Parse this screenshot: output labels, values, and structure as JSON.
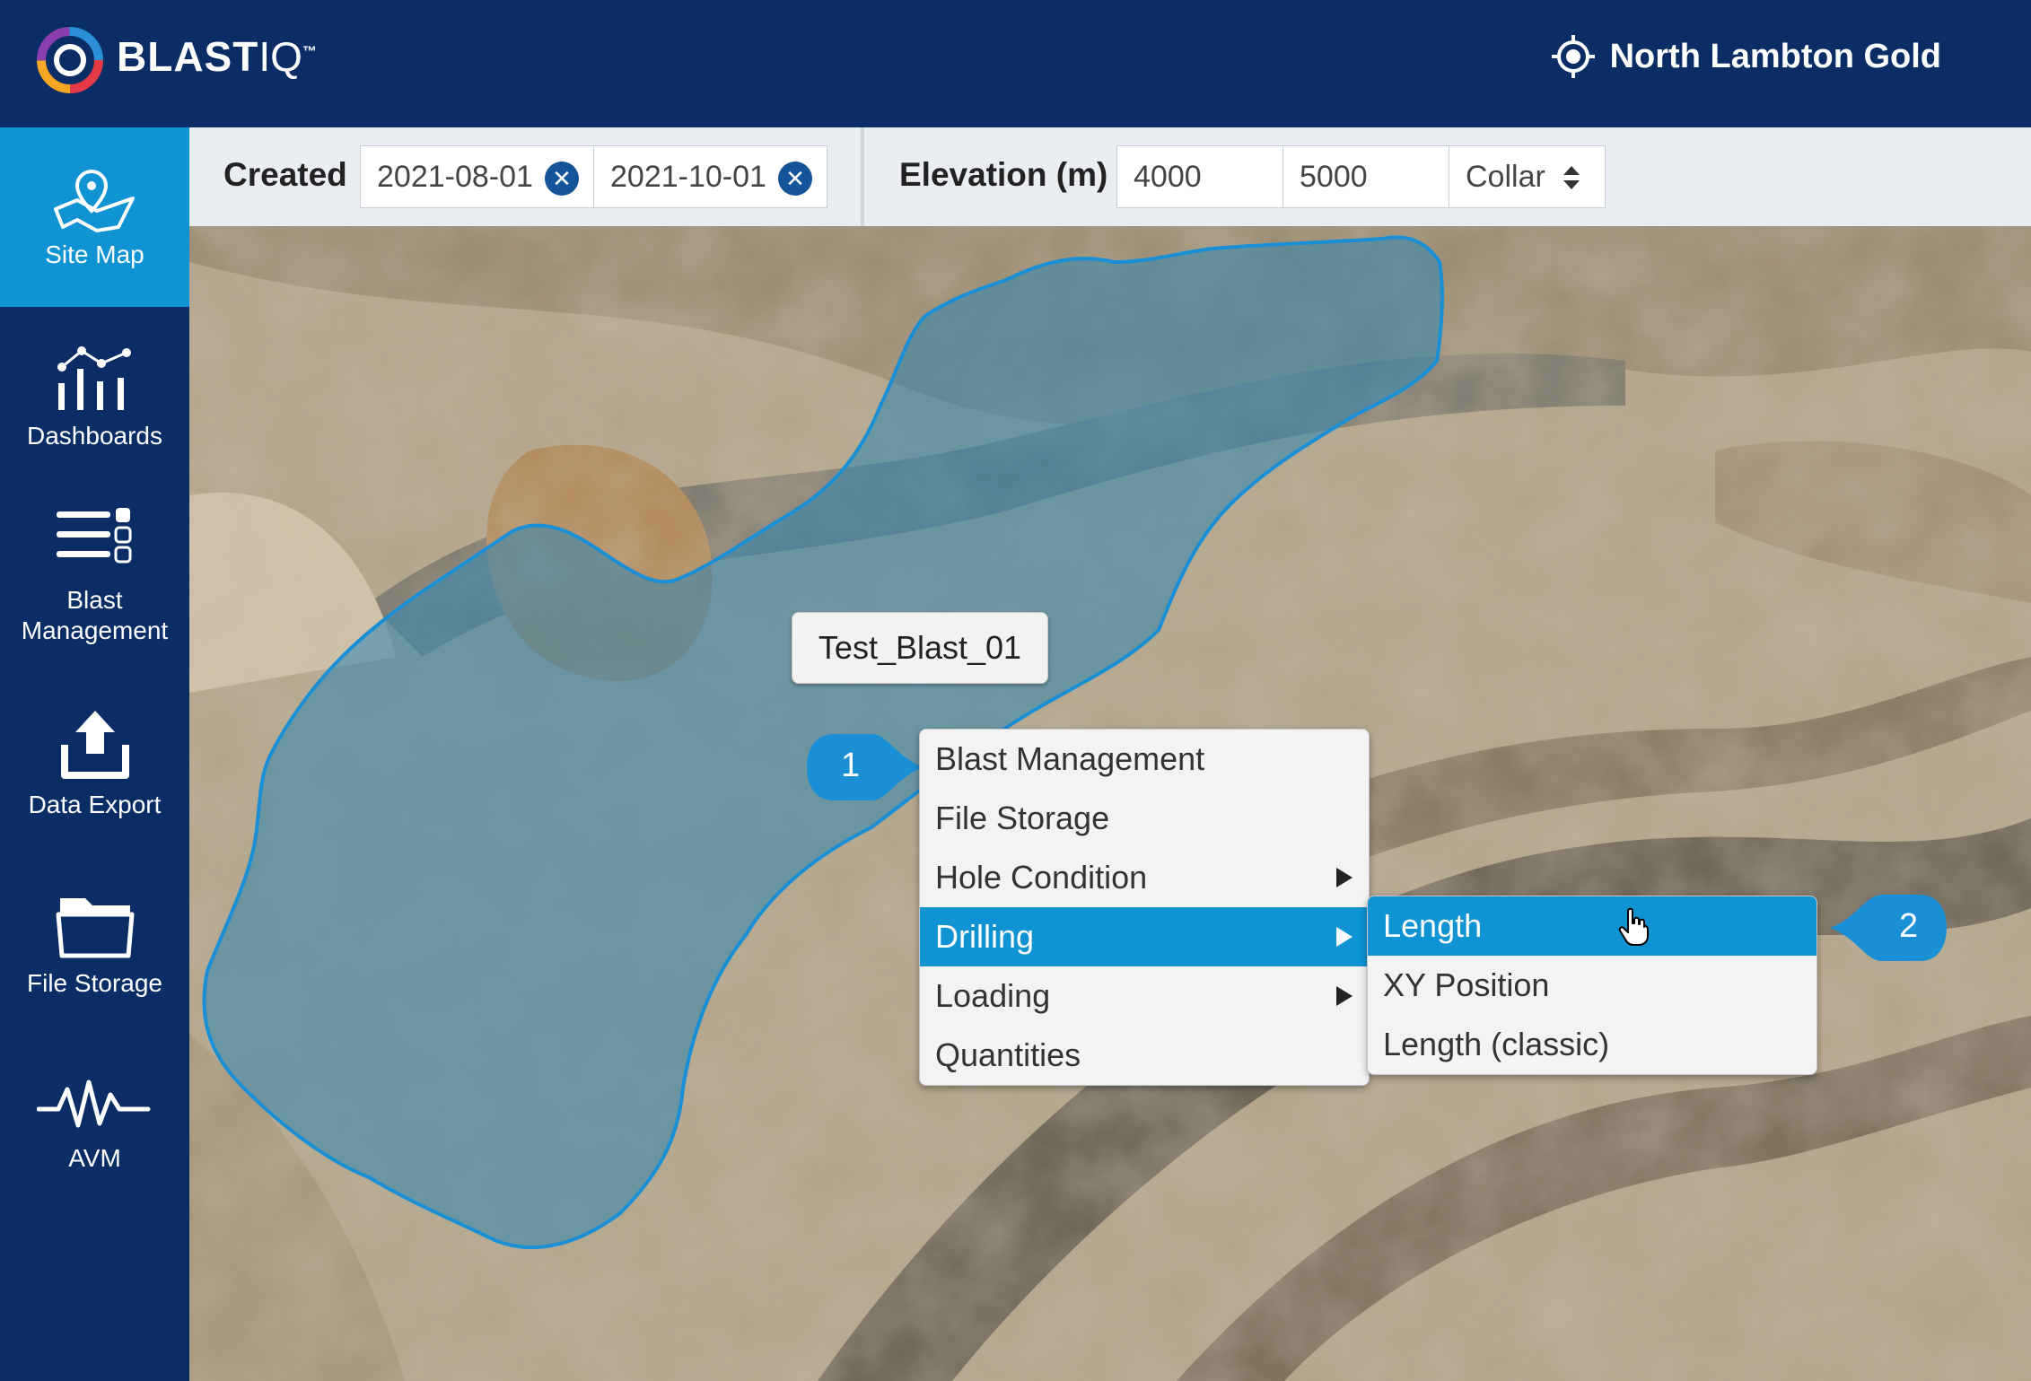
{
  "app": {
    "logo_text": "BLAST",
    "logo_suffix": "IQ",
    "logo_tm": "™",
    "site_name": "North Lambton Gold",
    "site_icon": "crosshair-target-icon"
  },
  "sidebar": {
    "items": [
      {
        "label": "Site Map",
        "icon": "map-pin-icon",
        "active": true
      },
      {
        "label": "Dashboards",
        "icon": "bar-line-chart-icon",
        "active": false
      },
      {
        "label": "Blast\nManagement",
        "icon": "list-settings-icon",
        "active": false
      },
      {
        "label": "Data Export",
        "icon": "upload-tray-icon",
        "active": false
      },
      {
        "label": "File Storage",
        "icon": "folder-icon",
        "active": false
      },
      {
        "label": "AVM",
        "icon": "waveform-icon",
        "active": false
      }
    ]
  },
  "filters": {
    "created_label": "Created",
    "created_from": "2021-08-01",
    "created_to": "2021-10-01",
    "elevation_label": "Elevation (m)",
    "elevation_min": "4000",
    "elevation_max": "5000",
    "elevation_reference": "Collar"
  },
  "map": {
    "blast_label": "Test_Blast_01",
    "polygon_color": "#1a8fd6"
  },
  "context_menu": {
    "items": [
      {
        "label": "Blast Management",
        "submenu": false,
        "highlighted": false
      },
      {
        "label": "File Storage",
        "submenu": false,
        "highlighted": false
      },
      {
        "label": "Hole Condition",
        "submenu": true,
        "highlighted": false
      },
      {
        "label": "Drilling",
        "submenu": true,
        "highlighted": true
      },
      {
        "label": "Loading",
        "submenu": true,
        "highlighted": false
      },
      {
        "label": "Quantities",
        "submenu": false,
        "highlighted": false
      }
    ]
  },
  "submenu": {
    "items": [
      {
        "label": "Length",
        "highlighted": true
      },
      {
        "label": "XY Position",
        "highlighted": false
      },
      {
        "label": "Length (classic)",
        "highlighted": false
      }
    ]
  },
  "callouts": {
    "first": "1",
    "second": "2"
  },
  "colors": {
    "navy": "#0b2d66",
    "accent": "#0f93d3",
    "clear_button": "#14559a"
  }
}
